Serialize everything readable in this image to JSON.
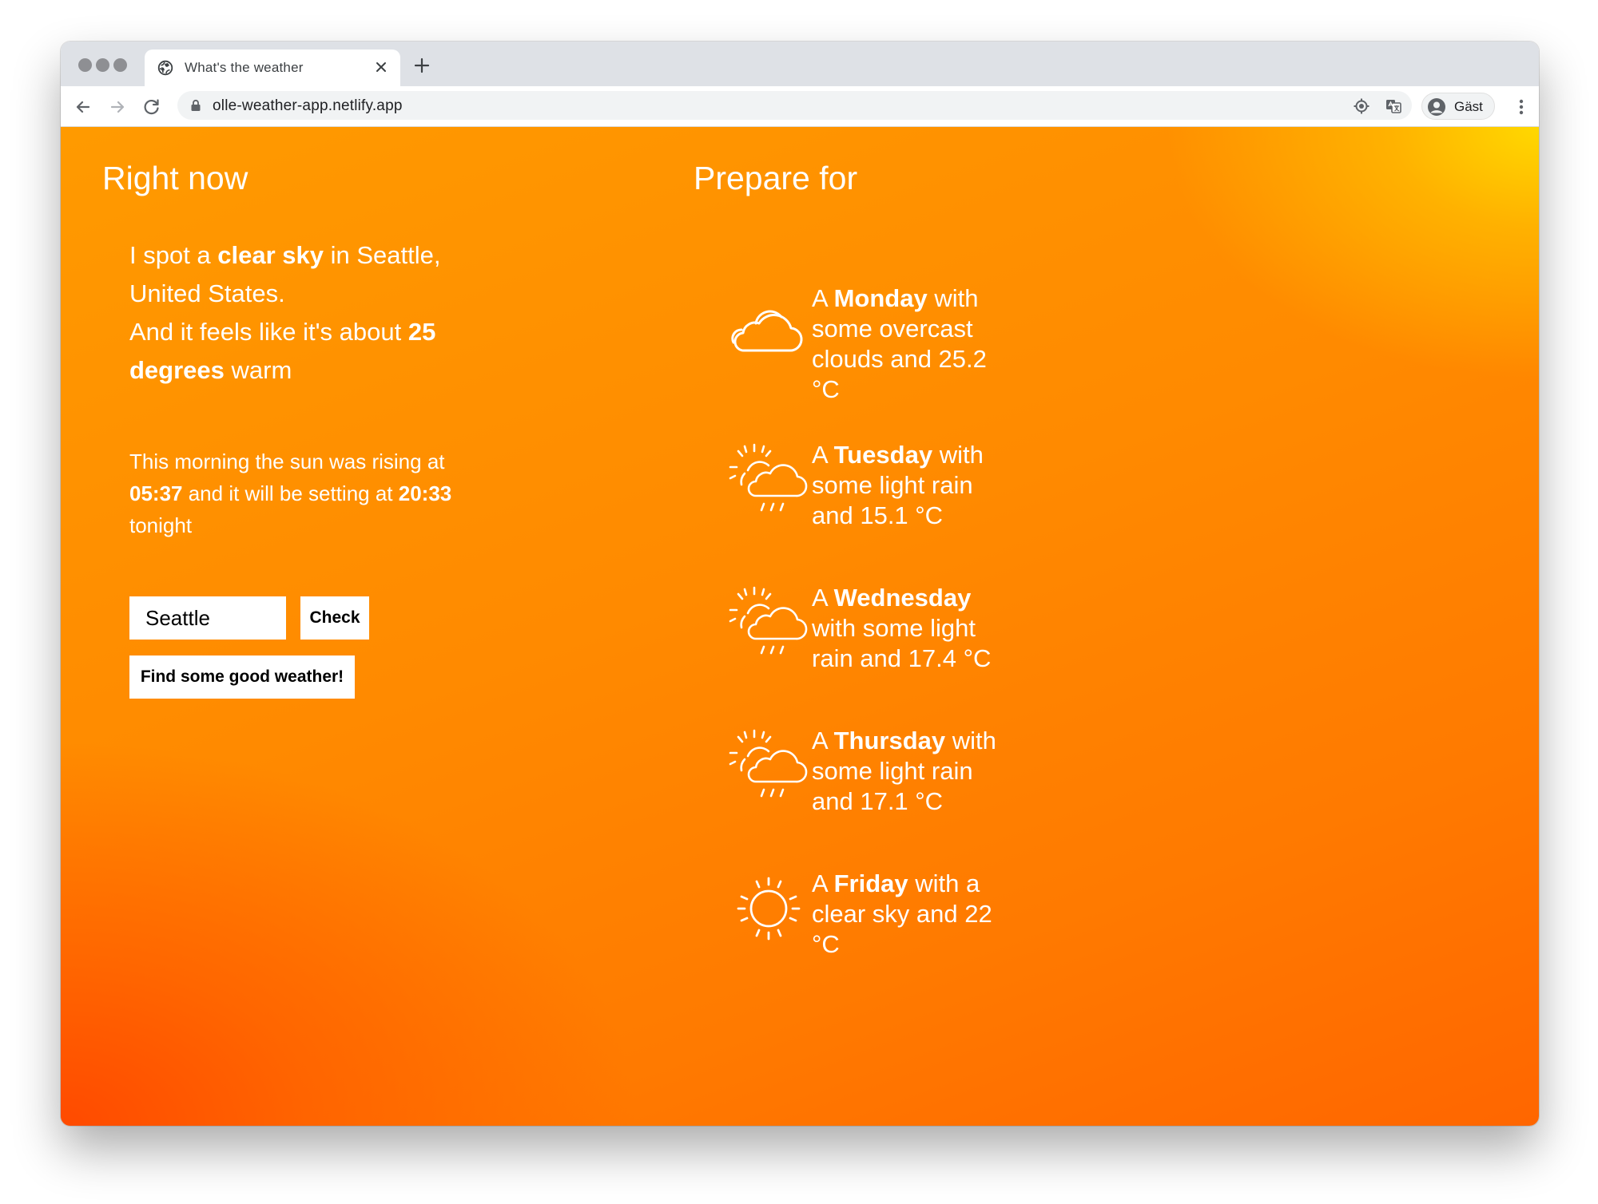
{
  "browser": {
    "tab_title": "What's the weather",
    "url": "olle-weather-app.netlify.app",
    "profile_name": "Gäst"
  },
  "now": {
    "heading": "Right now",
    "line_prefix": "I spot a ",
    "condition": "clear sky",
    "location": " in Seattle, United States.",
    "feels_prefix": "And it feels like it's about ",
    "degrees": "25 degrees",
    "feels_suffix": " warm",
    "sun_prefix": "This morning the sun was rising at ",
    "sunrise": "05:37",
    "sun_middle": " and it will be setting at ",
    "sunset": "20:33",
    "sun_suffix": " tonight"
  },
  "controls": {
    "city_value": "Seattle",
    "check_label": "Check",
    "good_weather_label": "Find some good weather!"
  },
  "forecast": {
    "heading": "Prepare for",
    "days": [
      {
        "prefix": "A ",
        "day": "Monday",
        "rest": " with some overcast clouds and 25.2 °C",
        "icon": "cloud-icon"
      },
      {
        "prefix": "A ",
        "day": "Tuesday",
        "rest": " with some light rain and 15.1 °C",
        "icon": "sun-cloud-rain-icon"
      },
      {
        "prefix": "A ",
        "day": "Wednesday",
        "rest": " with some light rain and 17.4 °C",
        "icon": "sun-cloud-rain-icon"
      },
      {
        "prefix": "A ",
        "day": "Thursday",
        "rest": " with some light rain and 17.1 °C",
        "icon": "sun-cloud-rain-icon"
      },
      {
        "prefix": "A ",
        "day": "Friday",
        "rest": " with a clear sky and 22 °C",
        "icon": "sun-icon"
      }
    ]
  },
  "colors": {
    "gradient_top_right": "#ffd500",
    "gradient_mid": "#ff8c00",
    "gradient_bottom_left": "#ff4400"
  }
}
